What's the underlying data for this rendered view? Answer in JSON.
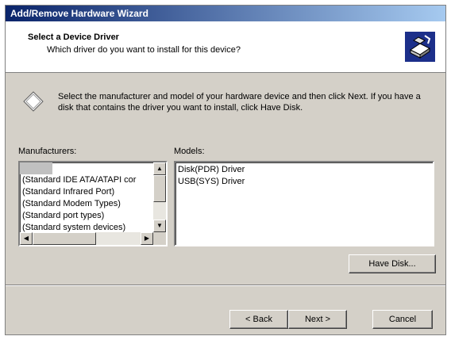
{
  "window": {
    "title": "Add/Remove Hardware Wizard"
  },
  "header": {
    "title": "Select a Device Driver",
    "subtitle": "Which driver do you want to install for this device?",
    "icon": "hardware-wizard-icon"
  },
  "instructions": {
    "text": "Select the manufacturer and model of your hardware device and then click Next. If you have a disk that contains the driver you want to install, click Have Disk.",
    "icon": "diamond-icon"
  },
  "manufacturers": {
    "label": "Manufacturers:",
    "items": [
      "",
      "(Standard IDE ATA/ATAPI cor",
      "(Standard Infrared Port)",
      "(Standard Modem Types)",
      "(Standard port types)",
      "(Standard system devices)"
    ]
  },
  "models": {
    "label": "Models:",
    "items": [
      "Disk(PDR) Driver",
      "USB(SYS) Driver"
    ]
  },
  "buttons": {
    "have_disk": "Have Disk...",
    "back": "< Back",
    "next": "Next >",
    "cancel": "Cancel"
  }
}
